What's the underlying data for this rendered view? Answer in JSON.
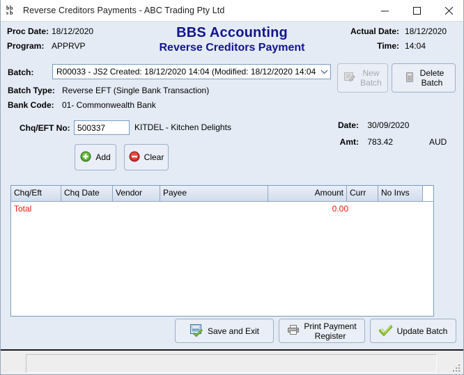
{
  "window": {
    "title": "Reverse Creditors Payments - ABC Trading Pty Ltd",
    "icon": "bbs-logo-icon",
    "minimize_label": "–",
    "maximize_label": "□",
    "close_label": "✕"
  },
  "header": {
    "proc_date_label": "Proc Date:",
    "proc_date_value": "18/12/2020",
    "program_label": "Program:",
    "program_value": "APPRVP",
    "app_title": "BBS Accounting",
    "app_subtitle": "Reverse Creditors Payment",
    "actual_date_label": "Actual Date:",
    "actual_date_value": "18/12/2020",
    "time_label": "Time:",
    "time_value": "14:04",
    "title_color": "#13158C"
  },
  "form": {
    "batch_label": "Batch:",
    "batch_value": "R00033 - JS2 Created: 18/12/2020 14:04 (Modified: 18/12/2020 14:04",
    "new_batch_label_line1": "New",
    "new_batch_label_line2": "Batch",
    "new_batch_enabled": "false",
    "delete_batch_label_line1": "Delete",
    "delete_batch_label_line2": "Batch",
    "batch_type_label": "Batch Type:",
    "batch_type_value": "Reverse EFT (Single Bank Transaction)",
    "bank_code_label": "Bank Code:",
    "bank_code_value": "01- Commonwealth Bank",
    "chq_eft_no_label": "Chq/EFT No:",
    "chq_eft_no_value": "500337",
    "chq_eft_no_placeholder": "",
    "vendor_text": "KITDEL - Kitchen Delights",
    "date_label": "Date:",
    "date_value": "30/09/2020",
    "amt_label": "Amt:",
    "amt_value": "783.42",
    "currency": "AUD",
    "add_label": "Add",
    "clear_label": "Clear"
  },
  "grid": {
    "columns": [
      {
        "label": "Chq/Eft",
        "align": "left"
      },
      {
        "label": "Chq Date",
        "align": "left"
      },
      {
        "label": "Vendor",
        "align": "left"
      },
      {
        "label": "Payee",
        "align": "left"
      },
      {
        "label": "Amount",
        "align": "right"
      },
      {
        "label": "Curr",
        "align": "left"
      },
      {
        "label": "No Invs",
        "align": "left"
      }
    ],
    "rows": [],
    "total_label": "Total",
    "total_amount": "0.00",
    "total_color": "#E01B00"
  },
  "footer": {
    "save_label": "Save and Exit",
    "print_label_line1": "Print Payment",
    "print_label_line2": "Register",
    "update_label": "Update Batch"
  },
  "statusbar": {
    "text": ""
  }
}
